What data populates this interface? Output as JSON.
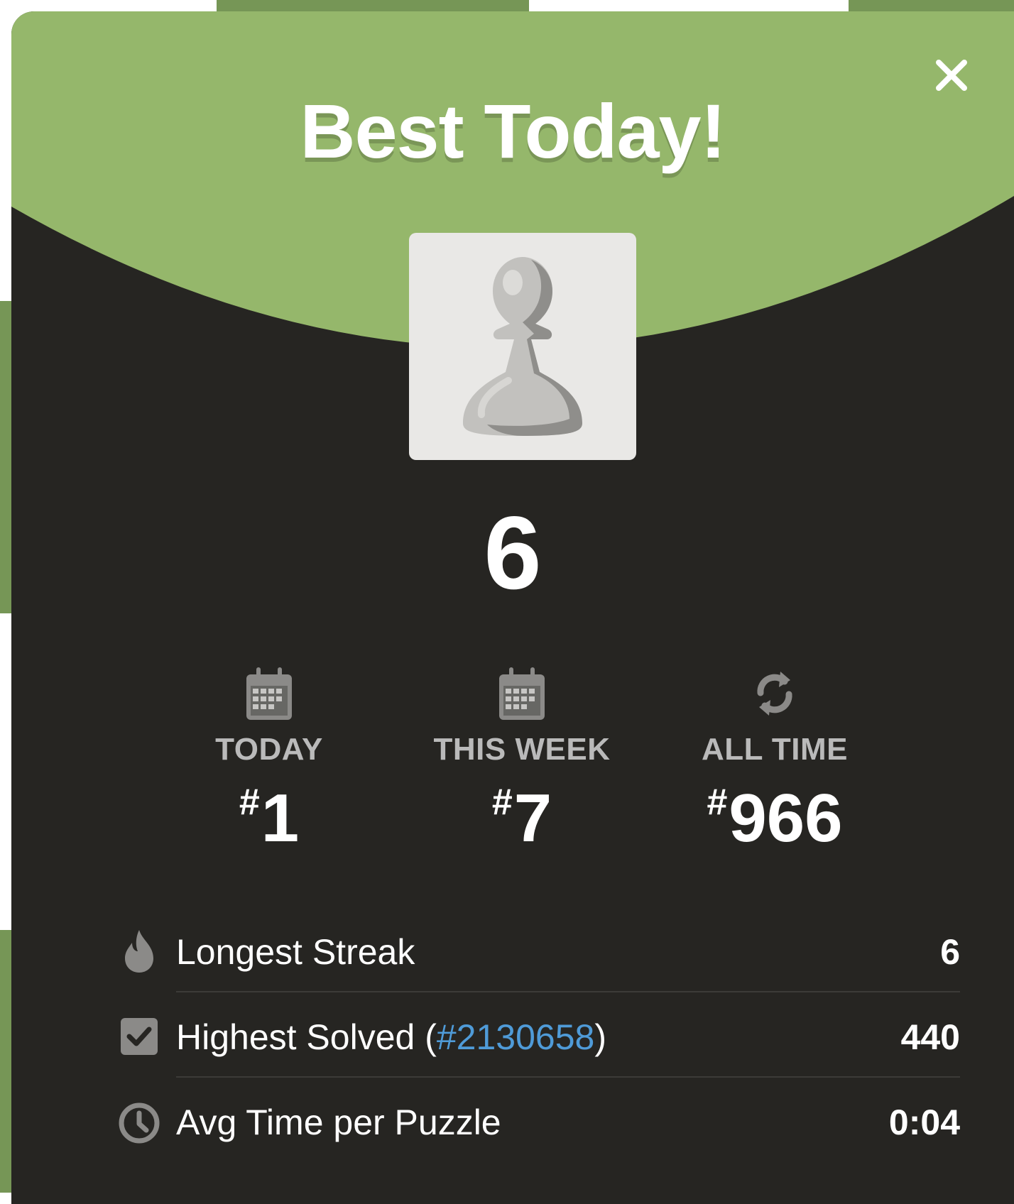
{
  "modal": {
    "title": "Best Today!",
    "score": "6",
    "piece_icon": "pawn-icon",
    "close_icon": "close-icon"
  },
  "rankings": [
    {
      "label": "TODAY",
      "hash": "#",
      "value": "1",
      "icon": "calendar-icon"
    },
    {
      "label": "THIS WEEK",
      "hash": "#",
      "value": "7",
      "icon": "calendar-icon"
    },
    {
      "label": "ALL TIME",
      "hash": "#",
      "value": "966",
      "icon": "refresh-icon"
    }
  ],
  "stats": {
    "streak": {
      "label": "Longest Streak",
      "value": "6",
      "icon": "flame-icon"
    },
    "highest": {
      "label": "Highest Solved",
      "open_paren": " (",
      "link": "#2130658",
      "close_paren": ")",
      "value": "440",
      "icon": "checkbox-icon"
    },
    "avg_time": {
      "label": "Avg Time per Puzzle",
      "value": "0:04",
      "icon": "clock-icon"
    }
  },
  "colors": {
    "header_green": "#95b76b",
    "modal_bg": "#262522",
    "link_blue": "#4f9bd8",
    "label_gray": "#bababa",
    "icon_gray": "#8b8a88"
  }
}
